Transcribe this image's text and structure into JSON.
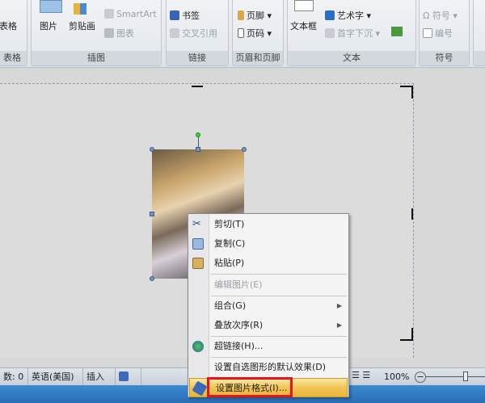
{
  "ribbon": {
    "groups": [
      {
        "label": "表格",
        "items": [
          "表格"
        ]
      },
      {
        "label": "插图",
        "items": [
          "图片",
          "剪贴画",
          "SmartArt",
          "图表"
        ]
      },
      {
        "label": "链接",
        "items": [
          "书签",
          "交叉引用"
        ]
      },
      {
        "label": "页眉和页脚",
        "items": [
          "页脚",
          "页码"
        ]
      },
      {
        "label": "文本",
        "items": [
          "文本框",
          "艺术字",
          "首字下沉"
        ]
      },
      {
        "label": "符号",
        "items": [
          "符号",
          "编号"
        ]
      }
    ]
  },
  "context_menu": {
    "items": [
      {
        "label": "剪切(T)",
        "icon": "scissors-icon"
      },
      {
        "label": "复制(C)",
        "icon": "copy-icon"
      },
      {
        "label": "粘贴(P)",
        "icon": "paste-icon"
      },
      {
        "label": "编辑图片(E)",
        "disabled": true
      },
      {
        "label": "组合(G)",
        "submenu": true
      },
      {
        "label": "叠放次序(R)",
        "submenu": true
      },
      {
        "label": "超链接(H)...",
        "icon": "hyperlink-icon"
      },
      {
        "label": "设置自选图形的默认效果(D)"
      },
      {
        "label": "设置图片格式(I)...",
        "icon": "format-picture-icon",
        "highlighted": true
      }
    ]
  },
  "status": {
    "words": "数: 0",
    "language": "英语(美国)",
    "mode": "插入",
    "zoom": "100%"
  },
  "colors": {
    "highlight": "#f2c454",
    "annotation": "#e8141c"
  }
}
